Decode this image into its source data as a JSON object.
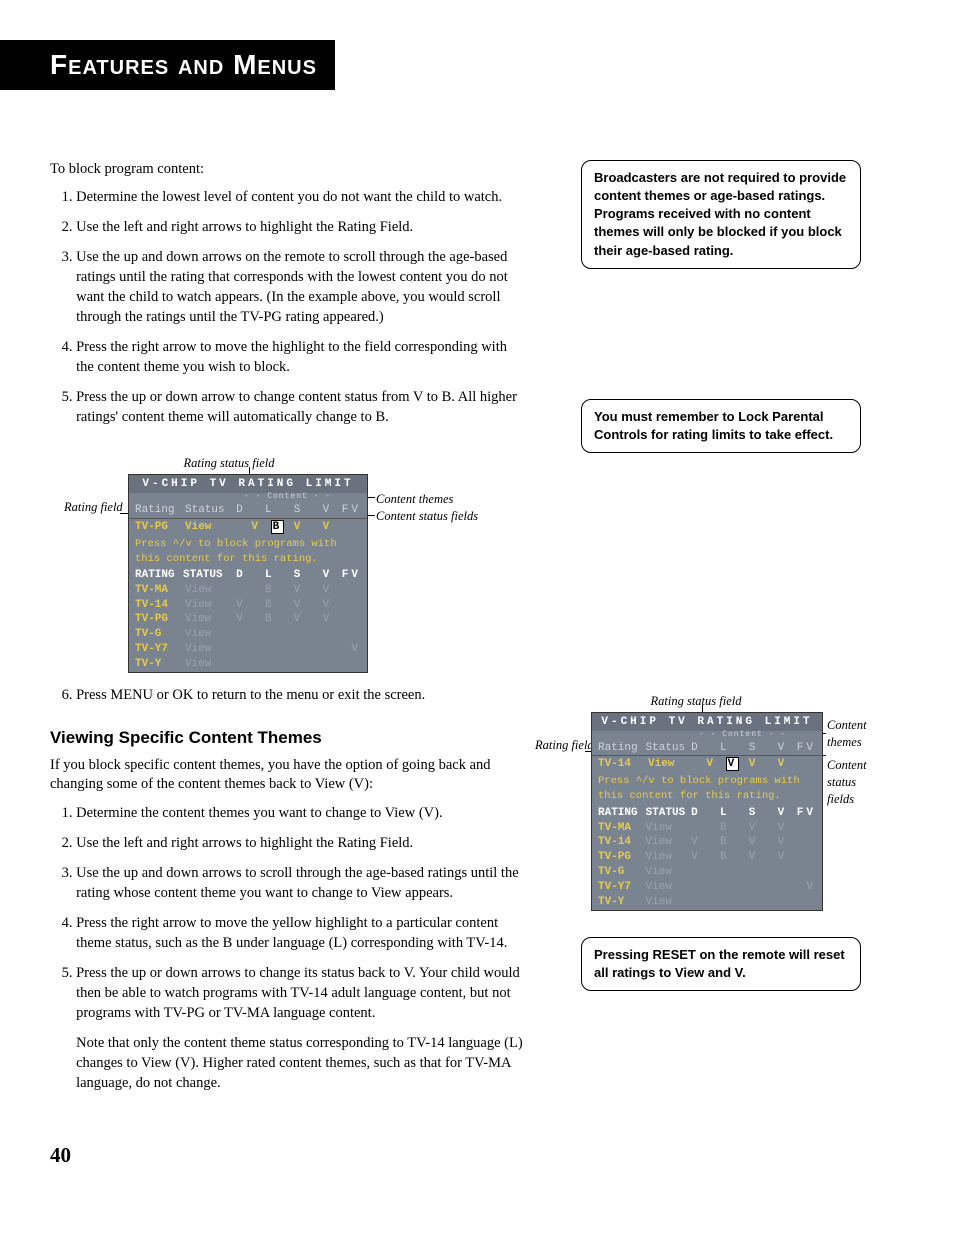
{
  "header": {
    "title": "Features and Menus"
  },
  "page_number": "40",
  "intro1": "To block program content:",
  "steps_a": [
    "Determine the lowest level of content you do not want the child to watch.",
    "Use the left and right arrows to highlight the Rating Field.",
    "Use the up and down arrows on the remote to scroll through the age-based ratings until the rating that corresponds with the lowest content you do not want the child to watch appears.  (In the example above, you would scroll through the ratings until the TV-PG rating appeared.)",
    "Press the right arrow to move the highlight to the field corresponding with the content theme you wish to block.",
    "Press the up or down arrow to change content status from V to B. All higher ratings' content theme will automatically change to B."
  ],
  "steps_a_tail": [
    "Press MENU or OK to return to the menu or exit the screen."
  ],
  "section2_title": "Viewing Specific Content Themes",
  "section2_intro": "If you block specific content themes, you have the option of going back and changing some of the content themes back to View (V):",
  "steps_b": [
    "Determine the content themes you want to change to View (V).",
    "Use the left and right arrows to highlight the Rating Field.",
    "Use the up and down arrows to scroll through the age-based ratings until the rating whose content theme you want to change to View appears.",
    "Press the right arrow to move the yellow highlight to a particular content theme status, such as the B under language (L) corresponding with TV-14.",
    "Press the up or down arrows to change its status back to V.  Your child would then be able to watch programs with TV-14 adult language content, but not programs with  TV-PG or TV-MA language content."
  ],
  "steps_b_note": "Note that only the content theme status corresponding to TV-14 language (L) changes to View (V). Higher rated content themes, such as that for TV-MA language, do not change.",
  "note_boxes": {
    "n1": "Broadcasters are not required to provide content themes or age-based ratings. Programs received with no content themes will only be blocked if you block their age-based rating.",
    "n2": "You must remember to Lock Parental Controls for rating limits to take effect.",
    "n3": "Pressing RESET on the remote will reset all ratings to View and V."
  },
  "fig_labels": {
    "top": "Rating status field",
    "left": "Rating field",
    "right_themes": "Content themes",
    "right_status": "Content status fields",
    "right_status_small": "Content status fields"
  },
  "panel": {
    "title": "V-CHIP TV RATING LIMIT",
    "subtitle": "- - Content - -",
    "hdr_rating": "Rating",
    "hdr_status": "Status",
    "hdr_flags": "D  L  S  V FV",
    "sel_rating_a": "TV-PG",
    "sel_status": "View",
    "sel_flags_a_pre": "V ",
    "sel_flags_a_box": "B",
    "sel_flags_a_post": " V  V   ",
    "msg1": "Press ^/v to block programs with",
    "msg2": "this content for this rating.",
    "thead_rating": "RATING",
    "thead_status": "STATUS",
    "rows": [
      {
        "r": "TV-MA",
        "s": "View",
        "f": "   B  V  V   "
      },
      {
        "r": "TV-14",
        "s": "View",
        "f": "V  B  V  V   "
      },
      {
        "r": "TV-PG",
        "s": "View",
        "f": "V  B  V  V   "
      },
      {
        "r": "TV-G",
        "s": "View",
        "f": "             "
      },
      {
        "r": "TV-Y7",
        "s": "View",
        "f": "            V"
      },
      {
        "r": "TV-Y",
        "s": "View",
        "f": "             "
      }
    ],
    "sel_rating_b": "TV-14",
    "sel_flags_b_pre": "V ",
    "sel_flags_b_box": "V",
    "sel_flags_b_post": " V  V   "
  }
}
